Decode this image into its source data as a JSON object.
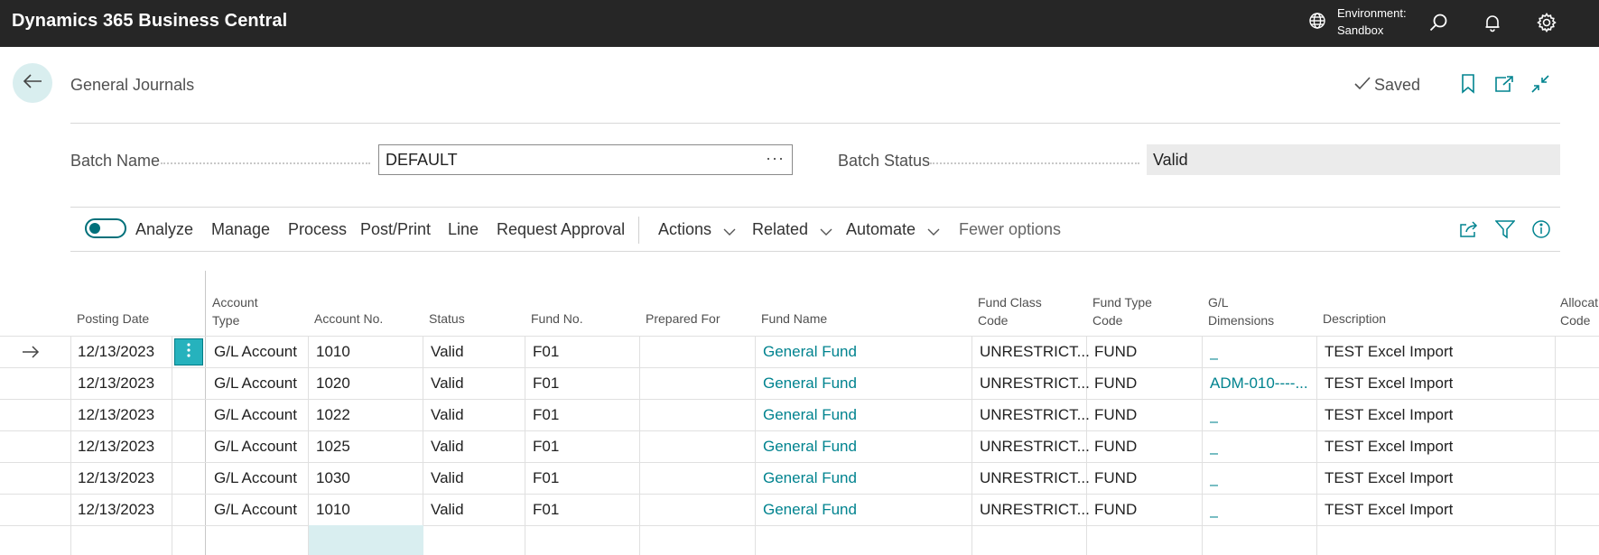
{
  "app": {
    "title": "Dynamics 365 Business Central",
    "environment_label": "Environment:",
    "environment_value": "Sandbox"
  },
  "header": {
    "back_icon": "arrow-left-icon",
    "page_title": "General Journals",
    "saved_label": "Saved"
  },
  "batch": {
    "name_label": "Batch Name",
    "name_value": "DEFAULT",
    "lookup_glyph": "···",
    "status_label": "Batch Status",
    "status_value": "Valid"
  },
  "actions": {
    "analyze": "Analyze",
    "items": [
      "Manage",
      "Process",
      "Post/Print",
      "Line",
      "Request Approval"
    ],
    "menus": [
      "Actions",
      "Related",
      "Automate"
    ],
    "fewer": "Fewer options"
  },
  "grid": {
    "headers": {
      "posting_date": "Posting Date",
      "account_type": [
        "Account",
        "Type"
      ],
      "account_no": "Account No.",
      "status": "Status",
      "fund_no": "Fund No.",
      "prepared_for": "Prepared For",
      "fund_name": "Fund Name",
      "fund_class": [
        "Fund Class",
        "Code"
      ],
      "fund_type": [
        "Fund Type",
        "Code"
      ],
      "gl_dim": [
        "G/L",
        "Dimensions"
      ],
      "description": "Description",
      "allocation": [
        "Allocat",
        "Code"
      ]
    },
    "rows": [
      {
        "date": "12/13/2023",
        "acct_type": "G/L Account",
        "acct_no": "1010",
        "status": "Valid",
        "fund_no": "F01",
        "prepared_for": "",
        "fund_name": "General Fund",
        "fund_class": "UNRESTRICT...",
        "fund_type": "FUND",
        "gl_dim": "_",
        "desc": "TEST Excel Import"
      },
      {
        "date": "12/13/2023",
        "acct_type": "G/L Account",
        "acct_no": "1020",
        "status": "Valid",
        "fund_no": "F01",
        "prepared_for": "",
        "fund_name": "General Fund",
        "fund_class": "UNRESTRICT...",
        "fund_type": "FUND",
        "gl_dim": "ADM-010----...",
        "desc": "TEST Excel Import"
      },
      {
        "date": "12/13/2023",
        "acct_type": "G/L Account",
        "acct_no": "1022",
        "status": "Valid",
        "fund_no": "F01",
        "prepared_for": "",
        "fund_name": "General Fund",
        "fund_class": "UNRESTRICT...",
        "fund_type": "FUND",
        "gl_dim": "_",
        "desc": "TEST Excel Import"
      },
      {
        "date": "12/13/2023",
        "acct_type": "G/L Account",
        "acct_no": "1025",
        "status": "Valid",
        "fund_no": "F01",
        "prepared_for": "",
        "fund_name": "General Fund",
        "fund_class": "UNRESTRICT...",
        "fund_type": "FUND",
        "gl_dim": "_",
        "desc": "TEST Excel Import"
      },
      {
        "date": "12/13/2023",
        "acct_type": "G/L Account",
        "acct_no": "1030",
        "status": "Valid",
        "fund_no": "F01",
        "prepared_for": "",
        "fund_name": "General Fund",
        "fund_class": "UNRESTRICT...",
        "fund_type": "FUND",
        "gl_dim": "_",
        "desc": "TEST Excel Import"
      },
      {
        "date": "12/13/2023",
        "acct_type": "G/L Account",
        "acct_no": "1010",
        "status": "Valid",
        "fund_no": "F01",
        "prepared_for": "",
        "fund_name": "General Fund",
        "fund_class": "UNRESTRICT...",
        "fund_type": "FUND",
        "gl_dim": "_",
        "desc": "TEST Excel Import"
      }
    ]
  },
  "colors": {
    "accent": "#00838f",
    "appbar": "#262626",
    "selected": "#26b2bd"
  }
}
